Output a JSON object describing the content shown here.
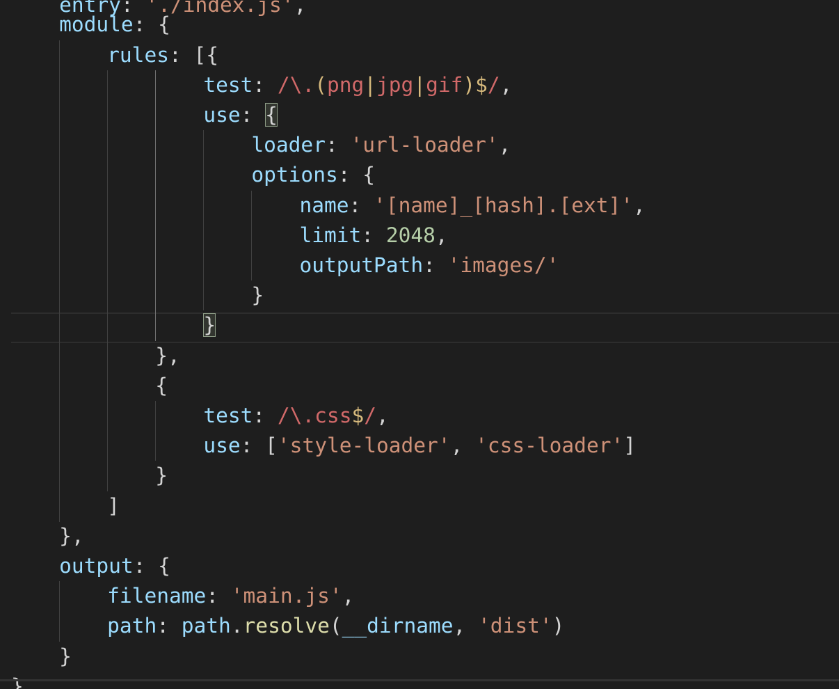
{
  "editor": {
    "language": "javascript",
    "colors": {
      "background": "#1e1e1e",
      "punctuation": "#d4d4d4",
      "property": "#9cdcfe",
      "string": "#ce9178",
      "number": "#b5cea8",
      "function": "#dcdcaa",
      "regexp": "#d16969",
      "regexp_operator": "#d7ba7d"
    },
    "cursor_line": 10,
    "highlighted_bracket_pair": [
      3,
      10
    ],
    "lines": [
      [
        [
          "key",
          "entry"
        ],
        [
          "p",
          ": "
        ],
        [
          "str",
          "'./index.js'"
        ],
        [
          "p",
          ","
        ]
      ],
      [
        [
          "key",
          "module"
        ],
        [
          "p",
          ": {"
        ]
      ],
      [
        [
          "key",
          "rules"
        ],
        [
          "p",
          ": [{"
        ]
      ],
      [
        [
          "key",
          "test"
        ],
        [
          "p",
          ": "
        ],
        [
          "re",
          "/\\."
        ],
        [
          "reop",
          "("
        ],
        [
          "re",
          "png"
        ],
        [
          "reop",
          "|"
        ],
        [
          "re",
          "jpg"
        ],
        [
          "reop",
          "|"
        ],
        [
          "re",
          "gif"
        ],
        [
          "reop",
          ")$"
        ],
        [
          "re",
          "/"
        ],
        [
          "p",
          ","
        ]
      ],
      [
        [
          "key",
          "use"
        ],
        [
          "p",
          ": "
        ],
        [
          "bm",
          "{"
        ]
      ],
      [
        [
          "key",
          "loader"
        ],
        [
          "p",
          ": "
        ],
        [
          "str",
          "'url-loader'"
        ],
        [
          "p",
          ","
        ]
      ],
      [
        [
          "key",
          "options"
        ],
        [
          "p",
          ": {"
        ]
      ],
      [
        [
          "key",
          "name"
        ],
        [
          "p",
          ": "
        ],
        [
          "str",
          "'[name]_[hash].[ext]'"
        ],
        [
          "p",
          ","
        ]
      ],
      [
        [
          "key",
          "limit"
        ],
        [
          "p",
          ": "
        ],
        [
          "num",
          "2048"
        ],
        [
          "p",
          ","
        ]
      ],
      [
        [
          "key",
          "outputPath"
        ],
        [
          "p",
          ": "
        ],
        [
          "str",
          "'images/'"
        ]
      ],
      [
        [
          "p",
          "}"
        ]
      ],
      [
        [
          "bm",
          "}"
        ]
      ],
      [
        [
          "p",
          "},"
        ]
      ],
      [
        [
          "p",
          "{"
        ]
      ],
      [
        [
          "key",
          "test"
        ],
        [
          "p",
          ": "
        ],
        [
          "re",
          "/\\.css"
        ],
        [
          "reop",
          "$"
        ],
        [
          "re",
          "/"
        ],
        [
          "p",
          ","
        ]
      ],
      [
        [
          "key",
          "use"
        ],
        [
          "p",
          ": ["
        ],
        [
          "str",
          "'style-loader'"
        ],
        [
          "p",
          ", "
        ],
        [
          "str",
          "'css-loader'"
        ],
        [
          "p",
          "]"
        ]
      ],
      [
        [
          "p",
          "}"
        ]
      ],
      [
        [
          "p",
          "]"
        ]
      ],
      [
        [
          "p",
          "},"
        ]
      ],
      [
        [
          "key",
          "output"
        ],
        [
          "p",
          ": {"
        ]
      ],
      [
        [
          "key",
          "filename"
        ],
        [
          "p",
          ": "
        ],
        [
          "str",
          "'main.js'"
        ],
        [
          "p",
          ","
        ]
      ],
      [
        [
          "key",
          "path"
        ],
        [
          "p",
          ": "
        ],
        [
          "key",
          "path"
        ],
        [
          "p",
          "."
        ],
        [
          "fn",
          "resolve"
        ],
        [
          "p",
          "("
        ],
        [
          "key",
          "__dirname"
        ],
        [
          "p",
          ", "
        ],
        [
          "str",
          "'dist'"
        ],
        [
          "p",
          ")"
        ]
      ],
      [
        [
          "p",
          "}"
        ]
      ],
      [
        [
          "p",
          "}"
        ]
      ]
    ]
  }
}
